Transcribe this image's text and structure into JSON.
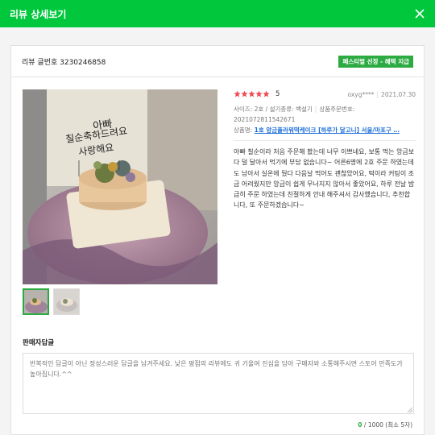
{
  "header": {
    "title": "리뷰 상세보기"
  },
  "review_no": {
    "label": "리뷰 글번호 3230246858",
    "badge": "페스티벌 선정 - 혜택 지급"
  },
  "rating": {
    "stars": 5,
    "score": "5"
  },
  "writer": {
    "id": "oxyg****",
    "date": "2021.07.30"
  },
  "meta": {
    "size_line": "사이즈: 2호 / 설기종류: 백설기",
    "order_no_label": "상품주문번호:",
    "order_no": "2021072811542671",
    "product_label": "상품명:",
    "product_name": "1호 앙금플라워떡케이크 [하루가 달고니] 서울/마포구 …"
  },
  "review_text": "아빠 칠순이라 처음 주문해 봤는데 너무 이쁘네요, 보통 먹는 앙금보다 덜 달아서 먹기에 부담 없습니다~ 어른6명에 2호 주문 하였는데도 남아서 실온에 뒀다 다음날 먹어도 괜찮았어요, 떡이라 커팅이 조금 어려웠지만 앙금이 쉽게 무너지지 않아서 좋았어요, 하루 전날 밤 급히 주문 하였는데 친절하게 안내 해주셔서 감사했습니다, 추천합니다, 또 주문하겠습니다~",
  "photo": {
    "cake_text_1": "아빠",
    "cake_text_2": "칠순축하드려요",
    "cake_text_3": "사랑해요"
  },
  "seller_reply": {
    "label": "판매자답글",
    "placeholder": "반복적인 답글이 아닌 정성스러운 답글을 남겨주세요. 낮은 평점의 리뷰에도 귀 기울여 진심을 담아 구매자와 소통해주시면 스토어 만족도가 높아집니다.^^",
    "count": "0",
    "limit": "/ 1000 (최소 5자)"
  },
  "colors": {
    "brand": "#00c73c",
    "badge": "#2dab43",
    "star": "#f04a54",
    "link": "#1e6fd8"
  }
}
